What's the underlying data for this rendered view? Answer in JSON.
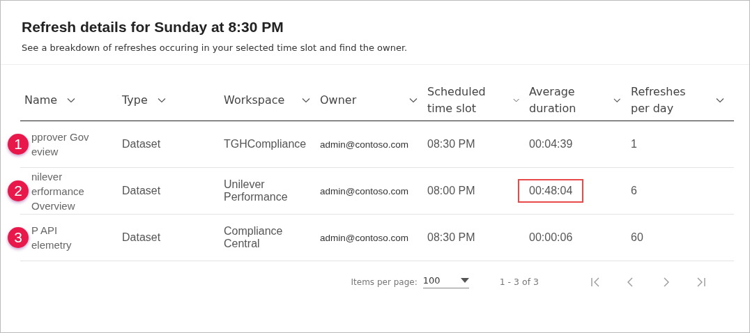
{
  "title": "Refresh details for Sunday at 8:30 PM",
  "subtitle": "See a breakdown of refreshes occuring in your selected time slot and find the owner.",
  "table": {
    "columns": [
      {
        "label": "Name"
      },
      {
        "label": "Type"
      },
      {
        "label": "Workspace"
      },
      {
        "label": "Owner"
      },
      {
        "label": "Scheduled time slot"
      },
      {
        "label": "Average duration"
      },
      {
        "label": "Refreshes per day"
      }
    ],
    "rows": [
      {
        "badge": "1",
        "name_lines": [
          "pprover Gov",
          "eview"
        ],
        "type": "Dataset",
        "workspace": "TGHCompliance",
        "owner": "admin@contoso.com",
        "time_slot": "08:30 PM",
        "duration": "00:04:39",
        "duration_highlighted": false,
        "refreshes": "1"
      },
      {
        "badge": "2",
        "name_lines": [
          "nilever",
          "erformance",
          "Overview"
        ],
        "type": "Dataset",
        "workspace": "Unilever Performance",
        "owner": "admin@contoso.com",
        "time_slot": "08:00 PM",
        "duration": "00:48:04",
        "duration_highlighted": true,
        "refreshes": "6"
      },
      {
        "badge": "3",
        "name_lines": [
          "P API",
          "elemetry"
        ],
        "type": "Dataset",
        "workspace": "Compliance Central",
        "owner": "admin@contoso.com",
        "time_slot": "08:30 PM",
        "duration": "00:00:06",
        "duration_highlighted": false,
        "refreshes": "60"
      }
    ]
  },
  "pagination": {
    "items_per_page_label": "Items per page:",
    "items_per_page": "100",
    "range": "1 - 3 of 3"
  }
}
